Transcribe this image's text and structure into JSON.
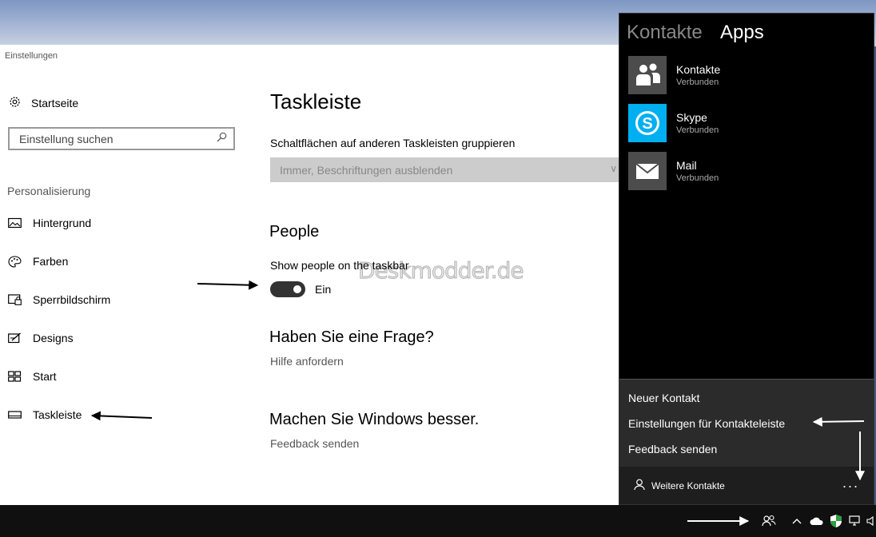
{
  "settings": {
    "window_title": "Einstellungen",
    "home_label": "Startseite",
    "search_placeholder": "Einstellung suchen",
    "section_label": "Personalisierung",
    "nav": [
      {
        "label": "Hintergrund",
        "icon": "picture-icon"
      },
      {
        "label": "Farben",
        "icon": "palette-icon"
      },
      {
        "label": "Sperrbildschirm",
        "icon": "lock-screen-icon"
      },
      {
        "label": "Designs",
        "icon": "themes-icon"
      },
      {
        "label": "Start",
        "icon": "start-icon"
      },
      {
        "label": "Taskleiste",
        "icon": "taskbar-icon"
      }
    ]
  },
  "page": {
    "title": "Taskleiste",
    "group_label": "Schaltflächen auf anderen Taskleisten gruppieren",
    "group_value": "Immer, Beschriftungen ausblenden",
    "people_heading": "People",
    "people_toggle_label": "Show people on the taskbar",
    "people_toggle_state": "Ein",
    "question_heading": "Haben Sie eine Frage?",
    "help_link": "Hilfe anfordern",
    "improve_heading": "Machen Sie Windows besser.",
    "feedback_link": "Feedback senden",
    "watermark": "Deskmodder.de"
  },
  "people_panel": {
    "tab_contacts": "Kontakte",
    "tab_apps": "Apps",
    "apps": [
      {
        "name": "Kontakte",
        "status": "Verbunden",
        "icon": "people-icon",
        "color": "#4c4c4c"
      },
      {
        "name": "Skype",
        "status": "Verbunden",
        "icon": "skype-icon",
        "color": "#00aff0"
      },
      {
        "name": "Mail",
        "status": "Verbunden",
        "icon": "mail-icon",
        "color": "#4c4c4c"
      }
    ],
    "menu": {
      "new_contact": "Neuer Kontakt",
      "settings": "Einstellungen für Kontakteleiste",
      "feedback": "Feedback senden"
    },
    "more_contacts": "Weitere Kontakte",
    "ellipsis": "..."
  },
  "colors": {
    "accent": "#000000",
    "toggle_on": "#333333",
    "skype": "#00aff0",
    "defender_green": "#2e9e3e"
  }
}
